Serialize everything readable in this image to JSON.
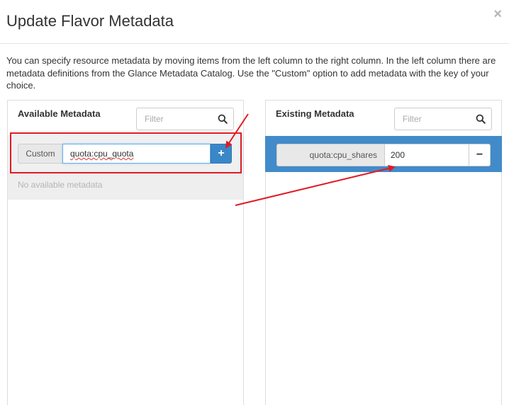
{
  "dialog": {
    "title": "Update Flavor Metadata",
    "close_symbol": "×",
    "description": "You can specify resource metadata by moving items from the left column to the right column. In the left column there are metadata definitions from the Glance Metadata Catalog. Use the \"Custom\" option to add metadata with the key of your choice."
  },
  "available": {
    "title": "Available Metadata",
    "filter_placeholder": "Filter",
    "custom_label": "Custom",
    "custom_value": "quota:cpu_quota",
    "add_symbol": "+",
    "empty_text": "No available metadata"
  },
  "existing": {
    "title": "Existing Metadata",
    "filter_placeholder": "Filter",
    "items": [
      {
        "key": "quota:cpu_shares",
        "value": "200"
      }
    ],
    "remove_symbol": "−"
  },
  "icons": {
    "search": "search-icon",
    "close": "close-icon",
    "plus": "plus-icon",
    "minus": "minus-icon"
  },
  "colors": {
    "primary": "#428bca",
    "add_button": "#3a87c8",
    "annotation": "#e01b24"
  }
}
